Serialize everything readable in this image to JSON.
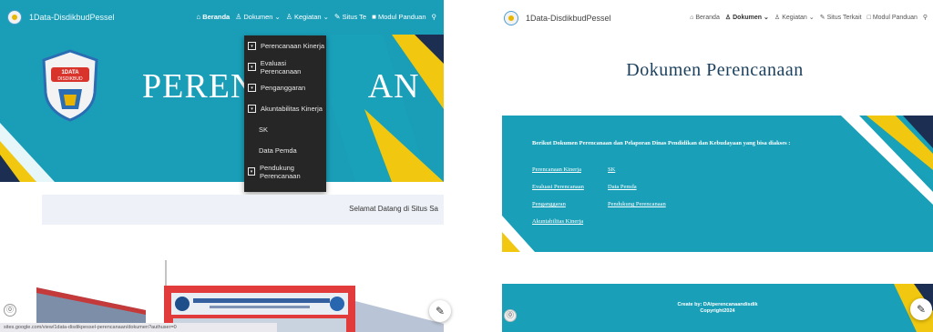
{
  "left": {
    "site_title": "1Data-DisdikbudPessel",
    "nav": {
      "beranda": "Beranda",
      "dokumen": "Dokumen",
      "kegiatan": "Kegiatan",
      "situs": "Situs Te",
      "modul": "Modul Panduan"
    },
    "hero_title": "PERENC",
    "hero_title_tail": "AN",
    "dropdown": [
      {
        "label": "Perencanaan Kinerja",
        "expandable": true
      },
      {
        "label": "Evaluasi Perencanaan",
        "expandable": true
      },
      {
        "label": "Penganggaran",
        "expandable": true
      },
      {
        "label": "Akuntabilitas Kinerja",
        "expandable": true
      },
      {
        "label": "SK",
        "expandable": false
      },
      {
        "label": "Data Pemda",
        "expandable": false
      },
      {
        "label": "Pendukung Perencanaan",
        "expandable": true
      }
    ],
    "welcome": "Selamat Datang di Situs Sa",
    "status_url": "sites.google.com/view/1data-disdikpessel-perencanaan/dokumen?authuser=0",
    "logo_text": "1DATA DISDIKBUD"
  },
  "right": {
    "site_title": "1Data-DisdikbudPessel",
    "nav": {
      "beranda": "Beranda",
      "dokumen": "Dokumen",
      "kegiatan": "Kegiatan",
      "situs": "Situs Terkait",
      "modul": "Modul Panduan"
    },
    "page_title": "Dokumen Perencanaan",
    "intro": "Berikut Dokumen Perencanaan dan Pelaporan Dinas Pendidikan dan Kebudayaan yang bisa diakses :",
    "links_col1": [
      "Perencanaan Kinerja",
      "Evaluasi Perencanaan",
      "Penganggaran",
      "Akuntabilitas Kinerja"
    ],
    "links_col2": [
      "SK",
      "Data Pemda",
      "Pendukung Perencanaan"
    ],
    "footer_line1": "Create by: DAtperencanaandisdik",
    "footer_line2": "Copyright2024"
  },
  "colors": {
    "teal": "#1a9eb8",
    "stripe_yellow": "#f1c80f",
    "stripe_navy": "#1c2f52",
    "dropdown_bg": "#262626"
  }
}
